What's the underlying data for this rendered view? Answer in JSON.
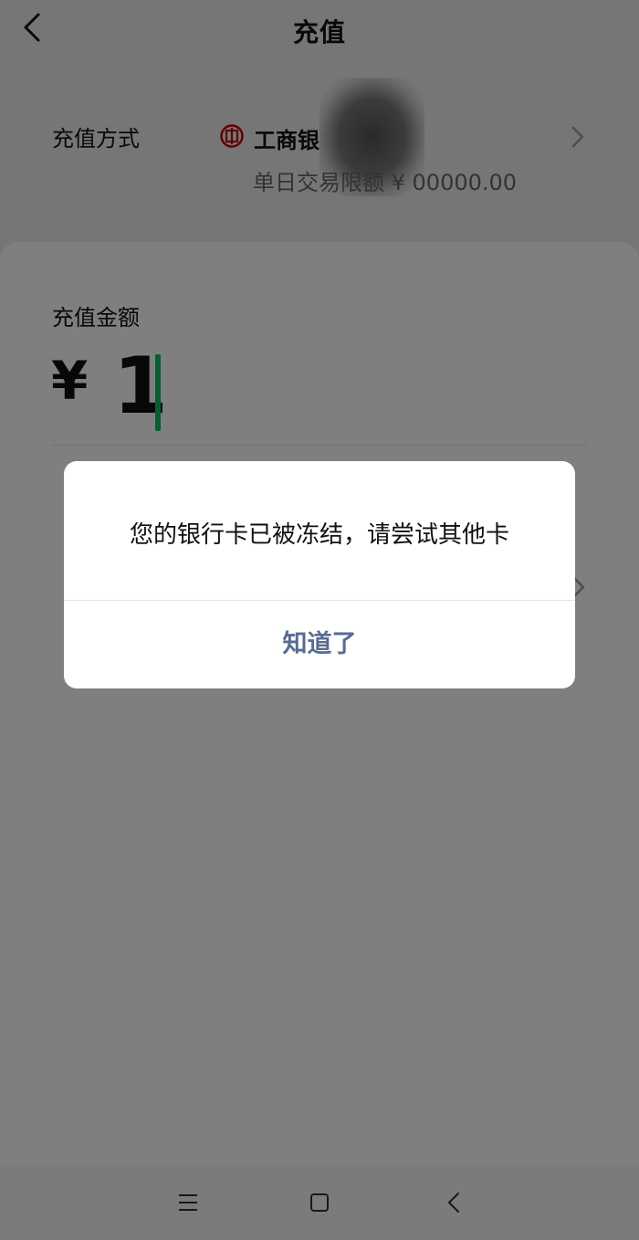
{
  "header": {
    "title": "充值"
  },
  "method": {
    "label": "充值方式",
    "bank_name": "工商银",
    "limit_text": "单日交易限额 ¥ 00000.00"
  },
  "amount": {
    "label": "充值金额",
    "currency": "¥",
    "value": "1"
  },
  "dialog": {
    "message": "您的银行卡已被冻结，请尝试其他卡",
    "confirm_label": "知道了"
  },
  "colors": {
    "accent_green": "#07c160",
    "dialog_button": "#576b95",
    "bank_red": "#c7000b"
  },
  "icons": {
    "back": "chevron-left-icon",
    "bank": "icbc-logo-icon",
    "row_chevron": "chevron-right-icon",
    "nav_menu": "menu-icon",
    "nav_home": "home-square-icon",
    "nav_back": "back-triangle-icon"
  }
}
